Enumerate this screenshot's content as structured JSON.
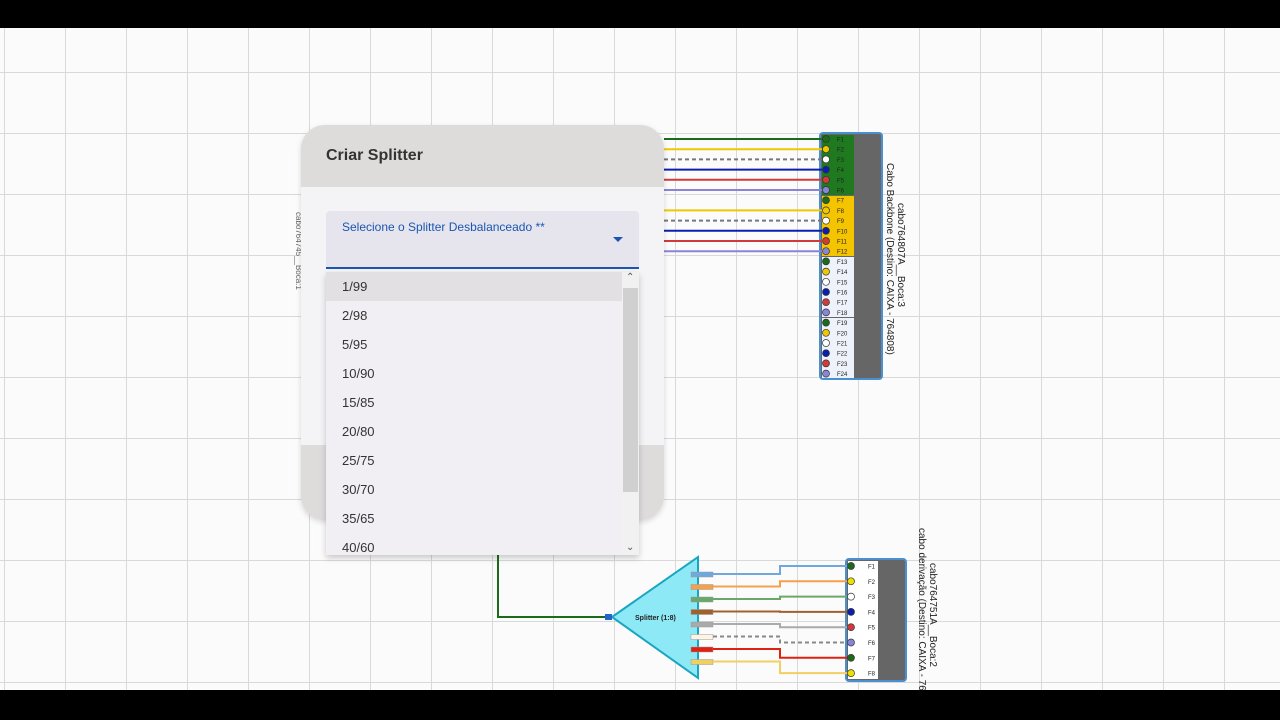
{
  "dialog": {
    "title": "Criar Splitter",
    "select_label": "Selecione o Splitter Desbalanceado **",
    "options": [
      "1/99",
      "2/98",
      "5/95",
      "10/90",
      "15/85",
      "20/80",
      "25/75",
      "30/70",
      "35/65",
      "40/60"
    ],
    "selected_index": 0
  },
  "backbone": {
    "name": "cabo764807A__Boca:3",
    "dest": "Cabo Backbone (Destino: CAIXA - 764808)",
    "fibers": [
      "F1",
      "F2",
      "F3",
      "F4",
      "F5",
      "F6",
      "F7",
      "F8",
      "F9",
      "F10",
      "F11",
      "F12",
      "F13",
      "F14",
      "F15",
      "F16",
      "F17",
      "F18",
      "F19",
      "F20",
      "F21",
      "F22",
      "F23",
      "F24"
    ]
  },
  "derivation": {
    "name": "cabo764751A__Boca:2",
    "dest": "cabo derivação (Destino: CAIXA - 76",
    "fibers": [
      "F1",
      "F2",
      "F3",
      "F4",
      "F5",
      "F6",
      "F7",
      "F8"
    ]
  },
  "splitter": {
    "label": "Splitter (1:8)"
  },
  "left_cable": {
    "label": "cabo764745__Boca:1"
  }
}
